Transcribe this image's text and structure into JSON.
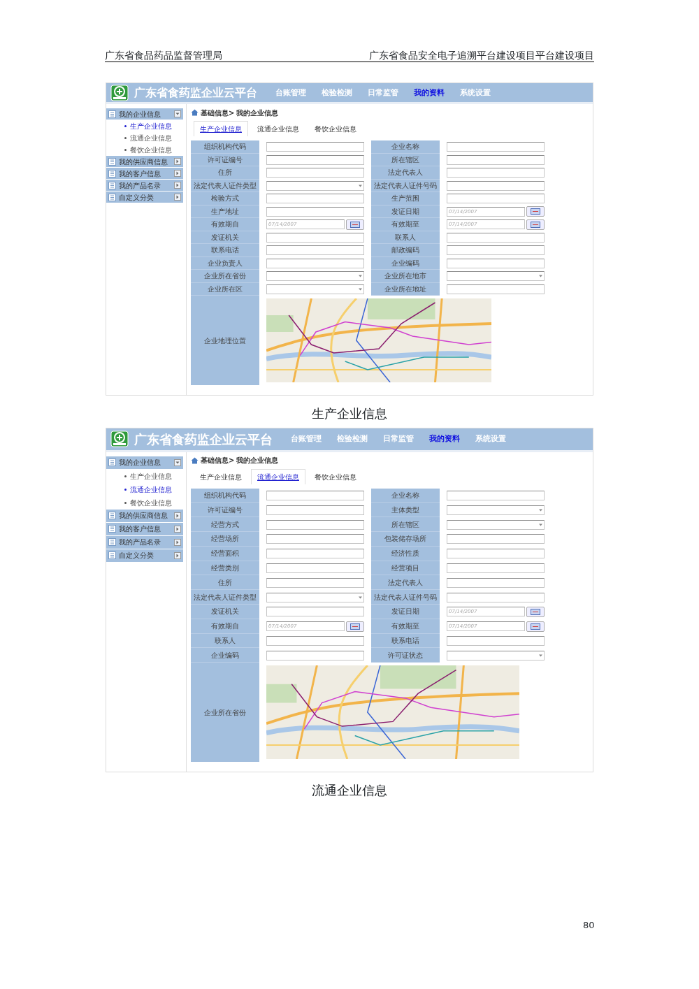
{
  "document_header": {
    "left": "广东省食品药品监督管理局",
    "right": "广东省食品安全电子追溯平台建设项目平台建设项目"
  },
  "figures": [
    {
      "app_title": "广东省食药监企业云平台",
      "nav": [
        {
          "label": "台账管理",
          "selected": false
        },
        {
          "label": "检验检测",
          "selected": false
        },
        {
          "label": "日常监管",
          "selected": false
        },
        {
          "label": "我的资料",
          "selected": true
        },
        {
          "label": "系统设置",
          "selected": false
        }
      ],
      "sidebar": [
        {
          "label": "我的企业信息",
          "expanded": true,
          "children": [
            {
              "label": "生产企业信息",
              "selected": true
            },
            {
              "label": "流通企业信息",
              "selected": false
            },
            {
              "label": "餐饮企业信息",
              "selected": false
            }
          ]
        },
        {
          "label": "我的供应商信息",
          "expanded": false
        },
        {
          "label": "我的客户信息",
          "expanded": false
        },
        {
          "label": "我的产品名录",
          "expanded": false
        },
        {
          "label": "自定义分类",
          "expanded": false
        }
      ],
      "breadcrumb": {
        "parent": "基础信息>",
        "current": "我的企业信息"
      },
      "tabs": [
        {
          "label": "生产企业信息",
          "selected": true
        },
        {
          "label": "流通企业信息",
          "selected": false
        },
        {
          "label": "餐饮企业信息",
          "selected": false
        }
      ],
      "left_fields": [
        {
          "label": "组织机构代码",
          "kind": "text"
        },
        {
          "label": "许可证编号",
          "kind": "text"
        },
        {
          "label": "住所",
          "kind": "text"
        },
        {
          "label": "法定代表人证件类型",
          "kind": "select"
        },
        {
          "label": "检验方式",
          "kind": "text"
        },
        {
          "label": "生产地址",
          "kind": "text"
        },
        {
          "label": "有效期自",
          "kind": "date",
          "placeholder": "07/14/2007"
        },
        {
          "label": "发证机关",
          "kind": "text"
        },
        {
          "label": "联系电话",
          "kind": "text"
        },
        {
          "label": "企业负责人",
          "kind": "text"
        },
        {
          "label": "企业所在省份",
          "kind": "select"
        },
        {
          "label": "企业所在区",
          "kind": "select"
        }
      ],
      "right_fields": [
        {
          "label": "企业名称",
          "kind": "text"
        },
        {
          "label": "所在辖区",
          "kind": "text"
        },
        {
          "label": "法定代表人",
          "kind": "text"
        },
        {
          "label": "法定代表人证件号码",
          "kind": "text"
        },
        {
          "label": "生产范围",
          "kind": "text"
        },
        {
          "label": "发证日期",
          "kind": "date",
          "placeholder": "07/14/2007"
        },
        {
          "label": "有效期至",
          "kind": "date",
          "placeholder": "07/14/2007"
        },
        {
          "label": "联系人",
          "kind": "text"
        },
        {
          "label": "邮政编码",
          "kind": "text"
        },
        {
          "label": "企业编码",
          "kind": "text"
        },
        {
          "label": "企业所在地市",
          "kind": "select"
        },
        {
          "label": "企业所在地址",
          "kind": "text"
        }
      ],
      "map_label": "企业地理位置",
      "caption": "生产企业信息"
    },
    {
      "app_title": "广东省食药监企业云平台",
      "nav": [
        {
          "label": "台账管理",
          "selected": false
        },
        {
          "label": "检验检测",
          "selected": false
        },
        {
          "label": "日常监管",
          "selected": false
        },
        {
          "label": "我的资料",
          "selected": true
        },
        {
          "label": "系统设置",
          "selected": false
        }
      ],
      "sidebar": [
        {
          "label": "我的企业信息",
          "expanded": true,
          "children": [
            {
              "label": "生产企业信息",
              "selected": false
            },
            {
              "label": "流通企业信息",
              "selected": true
            },
            {
              "label": "餐饮企业信息",
              "selected": false
            }
          ]
        },
        {
          "label": "我的供应商信息",
          "expanded": false
        },
        {
          "label": "我的客户信息",
          "expanded": false
        },
        {
          "label": "我的产品名录",
          "expanded": false
        },
        {
          "label": "自定义分类",
          "expanded": false
        }
      ],
      "breadcrumb": {
        "parent": "基础信息>",
        "current": "我的企业信息"
      },
      "tabs": [
        {
          "label": "生产企业信息",
          "selected": false
        },
        {
          "label": "流通企业信息",
          "selected": true
        },
        {
          "label": "餐饮企业信息",
          "selected": false
        }
      ],
      "left_fields": [
        {
          "label": "组织机构代码",
          "kind": "text"
        },
        {
          "label": "许可证编号",
          "kind": "text"
        },
        {
          "label": "经营方式",
          "kind": "text"
        },
        {
          "label": "经营场所",
          "kind": "text"
        },
        {
          "label": "经营面积",
          "kind": "text"
        },
        {
          "label": "经营类别",
          "kind": "text"
        },
        {
          "label": "住所",
          "kind": "text"
        },
        {
          "label": "法定代表人证件类型",
          "kind": "select"
        },
        {
          "label": "发证机关",
          "kind": "text"
        },
        {
          "label": "有效期自",
          "kind": "date",
          "placeholder": "07/14/2007"
        },
        {
          "label": "联系人",
          "kind": "text"
        },
        {
          "label": "企业编码",
          "kind": "text"
        }
      ],
      "right_fields": [
        {
          "label": "企业名称",
          "kind": "text"
        },
        {
          "label": "主体类型",
          "kind": "select"
        },
        {
          "label": "所在辖区",
          "kind": "select"
        },
        {
          "label": "包装储存场所",
          "kind": "text"
        },
        {
          "label": "经济性质",
          "kind": "text"
        },
        {
          "label": "经营项目",
          "kind": "text"
        },
        {
          "label": "法定代表人",
          "kind": "text"
        },
        {
          "label": "法定代表人证件号码",
          "kind": "text"
        },
        {
          "label": "发证日期",
          "kind": "date",
          "placeholder": "07/14/2007"
        },
        {
          "label": "有效期至",
          "kind": "date",
          "placeholder": "07/14/2007"
        },
        {
          "label": "联系电话",
          "kind": "text"
        },
        {
          "label": "许可证状态",
          "kind": "select"
        }
      ],
      "map_label": "企业所在省份",
      "caption": "流通企业信息"
    }
  ],
  "page_number": "80"
}
